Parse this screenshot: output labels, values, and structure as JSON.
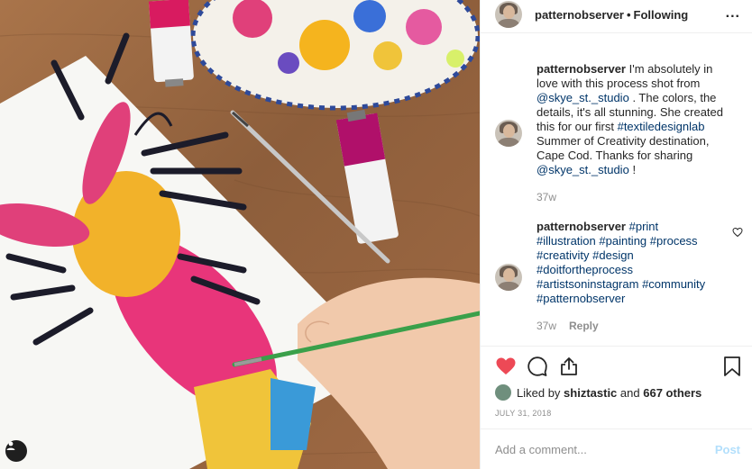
{
  "post_header": {
    "username": "patternobserver",
    "separator": "•",
    "follow_status": "Following",
    "more_label": "..."
  },
  "caption": {
    "username": "patternobserver",
    "text_1": "I'm absolutely in love with this process shot from",
    "mention_1": "@skye_st._studio",
    "text_2": ". The colors, the details, it's all stunning. She created this for our first",
    "hashtag": "#textiledesignlab",
    "text_3": "Summer of Creativity destination, Cape Cod. Thanks for sharing",
    "mention_2": "@skye_st._studio",
    "text_4": "!",
    "age": "37w"
  },
  "comment": {
    "username": "patternobserver",
    "tags": [
      "#print",
      "#illustration",
      "#painting",
      "#process",
      "#creativity",
      "#design",
      "#doitfortheprocess",
      "#artistsoninstagram",
      "#community",
      "#patternobserver"
    ],
    "age": "37w",
    "reply_label": "Reply"
  },
  "likes": {
    "prefix": "Liked by",
    "user": "shiztastic",
    "middle": "and",
    "others": "667 others"
  },
  "date": "JULY 31, 2018",
  "add_comment": {
    "placeholder": "Add a comment...",
    "post_label": "Post"
  },
  "icons": {
    "like": "heart-filled-icon",
    "comment": "comment-bubble-icon",
    "share": "share-icon",
    "save": "bookmark-icon",
    "comment_like": "heart-outline-icon",
    "tag_user": "user-tag-icon"
  },
  "colors": {
    "liked_heart": "#ed4956",
    "link": "#003569",
    "muted": "#8e8e8e",
    "post_disabled": "#b2dffc"
  }
}
